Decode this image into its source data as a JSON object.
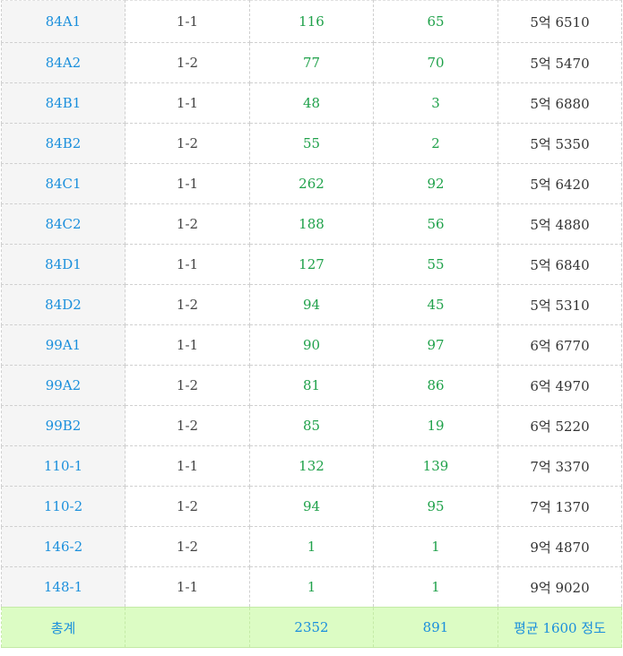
{
  "rows": [
    {
      "type": "84A1",
      "floor": "1-1",
      "supply": "116",
      "count": "65",
      "price": "5억 6510"
    },
    {
      "type": "84A2",
      "floor": "1-2",
      "supply": "77",
      "count": "70",
      "price": "5억 5470"
    },
    {
      "type": "84B1",
      "floor": "1-1",
      "supply": "48",
      "count": "3",
      "price": "5억 6880"
    },
    {
      "type": "84B2",
      "floor": "1-2",
      "supply": "55",
      "count": "2",
      "price": "5억 5350"
    },
    {
      "type": "84C1",
      "floor": "1-1",
      "supply": "262",
      "count": "92",
      "price": "5억 6420"
    },
    {
      "type": "84C2",
      "floor": "1-2",
      "supply": "188",
      "count": "56",
      "price": "5억 4880"
    },
    {
      "type": "84D1",
      "floor": "1-1",
      "supply": "127",
      "count": "55",
      "price": "5억 6840"
    },
    {
      "type": "84D2",
      "floor": "1-2",
      "supply": "94",
      "count": "45",
      "price": "5억 5310"
    },
    {
      "type": "99A1",
      "floor": "1-1",
      "supply": "90",
      "count": "97",
      "price": "6억 6770"
    },
    {
      "type": "99A2",
      "floor": "1-2",
      "supply": "81",
      "count": "86",
      "price": "6억 4970"
    },
    {
      "type": "99B2",
      "floor": "1-2",
      "supply": "85",
      "count": "19",
      "price": "6억 5220"
    },
    {
      "type": "110-1",
      "floor": "1-1",
      "supply": "132",
      "count": "139",
      "price": "7억 3370"
    },
    {
      "type": "110-2",
      "floor": "1-2",
      "supply": "94",
      "count": "95",
      "price": "7억 1370"
    },
    {
      "type": "146-2",
      "floor": "1-2",
      "supply": "1",
      "count": "1",
      "price": "9억 4870"
    },
    {
      "type": "148-1",
      "floor": "1-1",
      "supply": "1",
      "count": "1",
      "price": "9억 9020"
    }
  ],
  "total": {
    "label": "총계",
    "blank": "",
    "supply": "2352",
    "count": "891",
    "average": "평균 1600 정도"
  },
  "colors": {
    "type_text": "#1a8fdc",
    "number_text": "#1fa14a",
    "total_bg": "#dcfcc4",
    "first_col_bg": "#f5f5f5"
  }
}
